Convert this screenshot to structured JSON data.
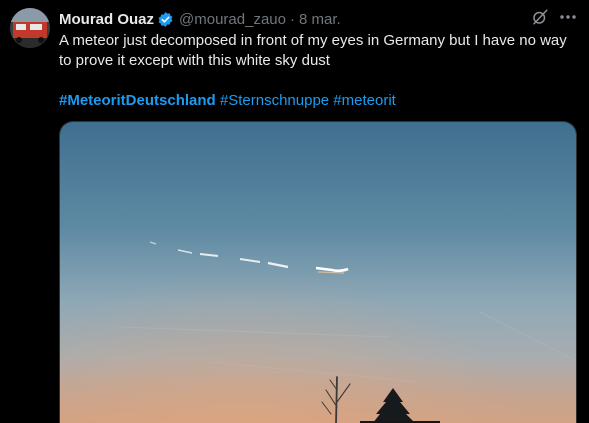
{
  "tweet": {
    "author": {
      "display_name": "Mourad Ouaz",
      "handle": "@mourad_zauo",
      "verified": true
    },
    "separator": "·",
    "date": "8 mar.",
    "text": "A meteor just decomposed in front of my eyes in Germany but I have no way to prove it except with this white sky dust",
    "hashtags": [
      "#MeteoritDeutschland",
      "#Sternschnuppe",
      "#meteorit"
    ]
  },
  "icons": {
    "verified": "verified-badge-icon",
    "grok": "grok-icon",
    "more": "more-icon"
  },
  "colors": {
    "background": "#000000",
    "text": "#e7e9ea",
    "muted": "#71767b",
    "link": "#1d9bf0"
  }
}
